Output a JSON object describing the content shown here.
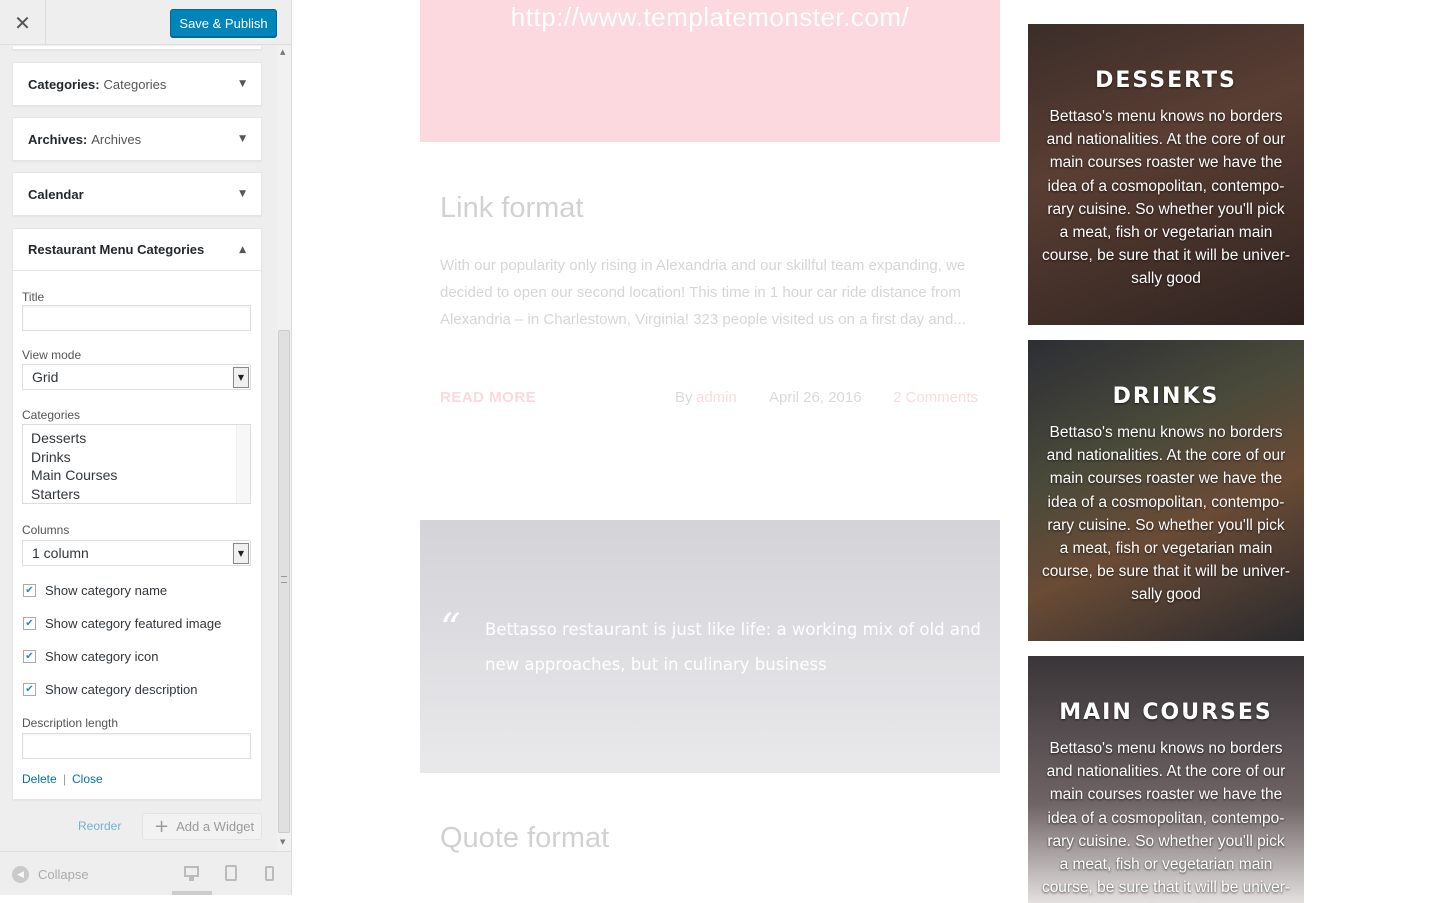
{
  "customizer": {
    "close_icon": "close-icon",
    "save_label": "Save & Publish",
    "widgets": [
      {
        "title": "Categories:",
        "subtitle": "Categories"
      },
      {
        "title": "Archives:",
        "subtitle": "Archives"
      },
      {
        "title": "Calendar",
        "subtitle": ""
      }
    ],
    "active_widget": {
      "title": "Restaurant Menu Categories",
      "title_label": "Title",
      "title_value": "",
      "view_mode_label": "View mode",
      "view_mode_value": "Grid",
      "categories_label": "Categories",
      "categories_options": [
        "Desserts",
        "Drinks",
        "Main Courses",
        "Starters"
      ],
      "columns_label": "Columns",
      "columns_value": "1 column",
      "checkboxes": [
        {
          "label": "Show category name",
          "checked": true
        },
        {
          "label": "Show category featured image",
          "checked": true
        },
        {
          "label": "Show category icon",
          "checked": true
        },
        {
          "label": "Show category description",
          "checked": true
        }
      ],
      "description_length_label": "Description length",
      "description_length_value": "",
      "delete_label": "Delete",
      "separator": "|",
      "close_label": "Close"
    },
    "reorder_label": "Reorder",
    "add_widget_label": "Add a Widget",
    "collapse_label": "Collapse",
    "device_icons": [
      "desktop-icon",
      "tablet-icon",
      "mobile-icon"
    ]
  },
  "preview": {
    "link_post": {
      "url": "http://www.templatemonster.com/",
      "title": "Link format",
      "excerpt": "With our popularity only rising in Alexandria and our skillful team expanding, we decided to open our second location! This time in 1 hour car ride distance from Alexandria – in Charlestown, Virginia! 323 people visited us on a first day and...",
      "read_more": "READ MORE",
      "by": "By",
      "author": "admin",
      "date": "April 26, 2016",
      "comments": "2 Comments"
    },
    "quote_post": {
      "quote_mark": "“",
      "quote": "Bettasso restaurant is just like life: a working mix of old and new approaches, but in culinary business",
      "title": "Quote format"
    },
    "menu_categories": [
      {
        "name": "DESSERTS",
        "description": "Bettaso's menu knows no borders and nationalities. At the core of our main courses roaster we have the idea of a cosmopolitan, contempo-rary cuisine. So whether you'll pick a meat, fish or vegetarian main course, be sure that it will be univer-sally good"
      },
      {
        "name": "DRINKS",
        "description": "Bettaso's menu knows no borders and nationalities. At the core of our main courses roaster we have the idea of a cosmopolitan, contempo-rary cuisine. So whether you'll pick a meat, fish or vegetarian main course, be sure that it will be univer-sally good"
      },
      {
        "name": "MAIN COURSES",
        "description": "Bettaso's menu knows no borders and nationalities. At the core of our main courses roaster we have the idea of a cosmopolitan, contempo-rary cuisine. So whether you'll pick a meat, fish or vegetarian main course, be sure that it will be univer-sally good"
      }
    ]
  },
  "colors": {
    "primary_button": "#0085ba",
    "link": "#0073aa",
    "accent_pink": "#e8576b",
    "link_block_bg": "#fbd9de",
    "quote_block_bg": "#d5d5d8"
  }
}
